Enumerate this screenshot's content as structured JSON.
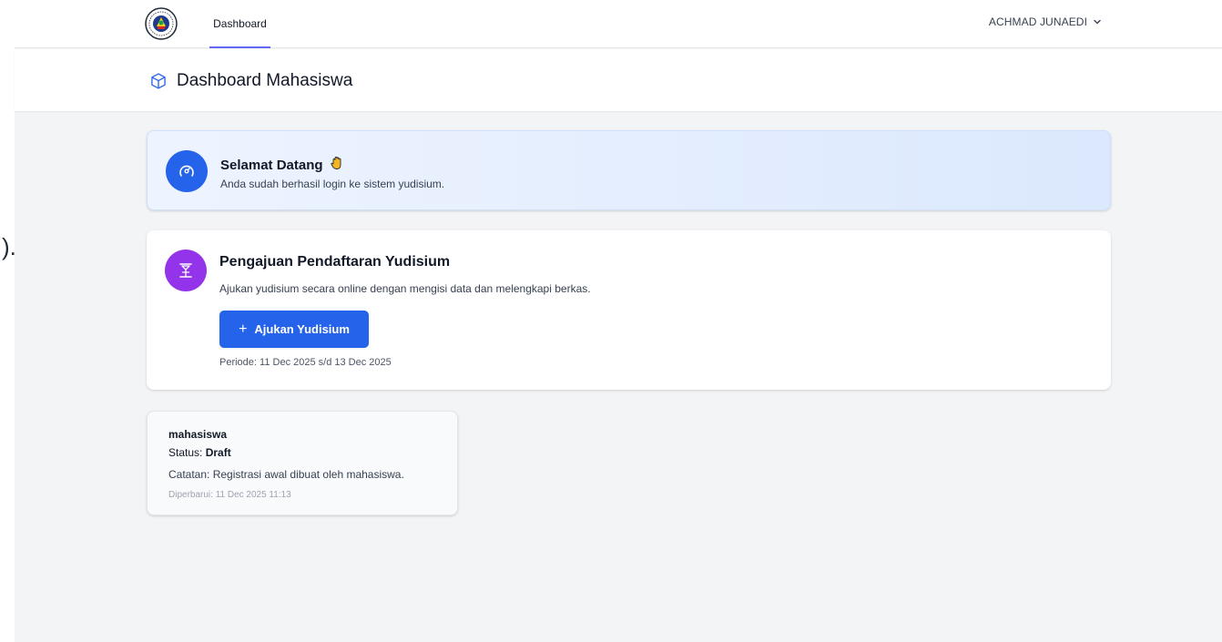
{
  "stray_glyph": ").",
  "nav": {
    "tab_dashboard": "Dashboard",
    "user_name": "ACHMAD JUNAEDI"
  },
  "header": {
    "title": "Dashboard Mahasiswa"
  },
  "welcome": {
    "title": "Selamat Datang",
    "subtitle": "Anda sudah berhasil login ke sistem yudisium."
  },
  "registration": {
    "title": "Pengajuan Pendaftaran Yudisium",
    "description": "Ajukan yudisium secara online dengan mengisi data dan melengkapi berkas.",
    "button_label": "Ajukan Yudisium",
    "period": "Periode: 11 Dec 2025 s/d 13 Dec 2025"
  },
  "status_card": {
    "role": "mahasiswa",
    "status_label": "Status:",
    "status_value": "Draft",
    "note": "Catatan: Registrasi awal dibuat oleh mahasiswa.",
    "updated": "Diperbarui: 11 Dec 2025 11:13"
  },
  "icons": {
    "logo": "university-seal-icon",
    "user_menu": "chevron-down-icon",
    "title": "cube-icon",
    "welcome": "gauge-icon",
    "welcome_emoji": "waving-hand-icon",
    "registration": "hourglass-icon",
    "button": "plus-icon"
  },
  "colors": {
    "primary": "#2563eb",
    "accent_purple": "#9333ea",
    "nav_indicator": "#6366f1",
    "background": "#f3f4f6"
  }
}
